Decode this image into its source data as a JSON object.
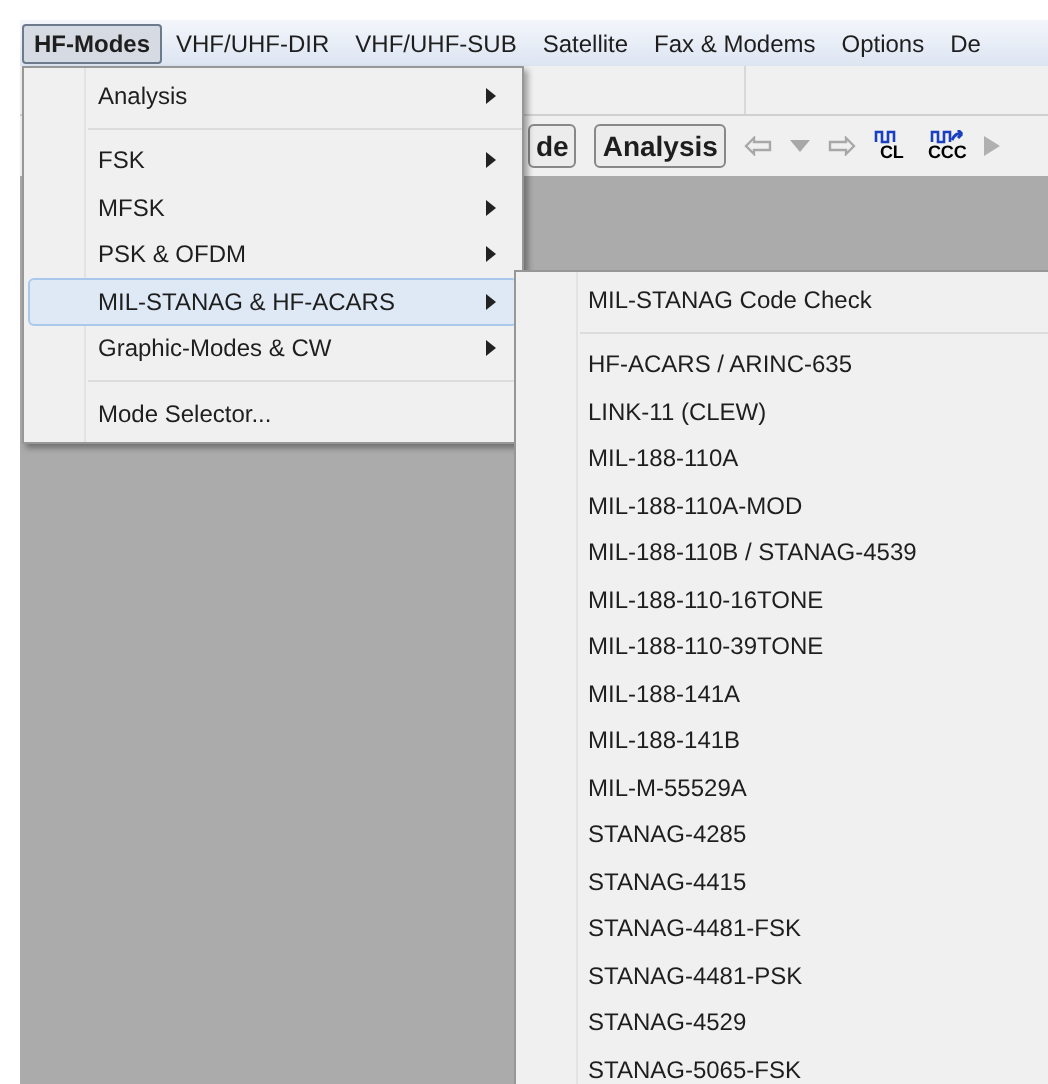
{
  "menubar": [
    {
      "label": "HF-Modes",
      "selected": true
    },
    {
      "label": "VHF/UHF-DIR",
      "selected": false
    },
    {
      "label": "VHF/UHF-SUB",
      "selected": false
    },
    {
      "label": "Satellite",
      "selected": false
    },
    {
      "label": "Fax & Modems",
      "selected": false
    },
    {
      "label": "Options",
      "selected": false
    },
    {
      "label": "De",
      "selected": false
    }
  ],
  "toolbar": {
    "mode_button": "de",
    "analysis_button": "Analysis",
    "cl_label": "CL",
    "ccc_label": "CCC"
  },
  "menu": {
    "items": [
      {
        "kind": "submenu",
        "label": "Analysis",
        "selected": false
      },
      {
        "kind": "separator"
      },
      {
        "kind": "submenu",
        "label": "FSK",
        "selected": false
      },
      {
        "kind": "submenu",
        "label": "MFSK",
        "selected": false
      },
      {
        "kind": "submenu",
        "label": "PSK & OFDM",
        "selected": false
      },
      {
        "kind": "submenu",
        "label": "MIL-STANAG & HF-ACARS",
        "selected": true
      },
      {
        "kind": "submenu",
        "label": "Graphic-Modes & CW",
        "selected": false
      },
      {
        "kind": "separator"
      },
      {
        "kind": "command",
        "label": "Mode Selector...",
        "selected": false
      }
    ]
  },
  "submenu": {
    "items": [
      {
        "kind": "command",
        "label": "MIL-STANAG Code Check"
      },
      {
        "kind": "separator"
      },
      {
        "kind": "command",
        "label": "HF-ACARS / ARINC-635"
      },
      {
        "kind": "command",
        "label": "LINK-11 (CLEW)"
      },
      {
        "kind": "command",
        "label": "MIL-188-110A"
      },
      {
        "kind": "command",
        "label": "MIL-188-110A-MOD"
      },
      {
        "kind": "command",
        "label": "MIL-188-110B / STANAG-4539"
      },
      {
        "kind": "command",
        "label": "MIL-188-110-16TONE"
      },
      {
        "kind": "command",
        "label": "MIL-188-110-39TONE"
      },
      {
        "kind": "command",
        "label": "MIL-188-141A"
      },
      {
        "kind": "command",
        "label": "MIL-188-141B"
      },
      {
        "kind": "command",
        "label": "MIL-M-55529A"
      },
      {
        "kind": "command",
        "label": "STANAG-4285"
      },
      {
        "kind": "command",
        "label": "STANAG-4415"
      },
      {
        "kind": "command",
        "label": "STANAG-4481-FSK"
      },
      {
        "kind": "command",
        "label": "STANAG-4481-PSK"
      },
      {
        "kind": "command",
        "label": "STANAG-4529"
      },
      {
        "kind": "command",
        "label": "STANAG-5065-FSK"
      }
    ]
  }
}
